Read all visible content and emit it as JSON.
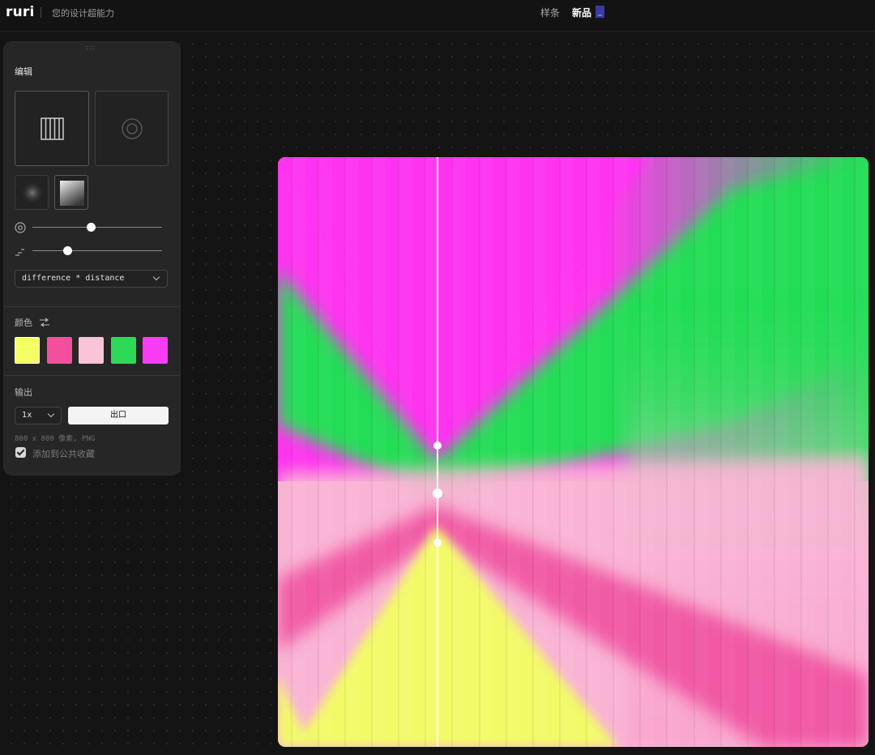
{
  "header": {
    "logo": "ruri",
    "tagline": "您的设计超能力",
    "nav": [
      "样条",
      "新品"
    ],
    "nav_badge": "_"
  },
  "panel": {
    "grip": ":::",
    "edit_title": "编辑",
    "dropdown_value": "difference * distance",
    "sliders": [
      {
        "icon": "concentric-circle-icon",
        "level": 0.45
      },
      {
        "icon": "gradient-ramp-icon",
        "level": 0.27
      }
    ],
    "colors_title": "颜色",
    "swatches": [
      "#f4ff63",
      "#f34f9e",
      "#fbc3d8",
      "#2ed957",
      "#f73cf4"
    ],
    "output_title": "输出",
    "scale_value": "1x",
    "export_label": "出口",
    "meta": "800 x 800 像素, PNG",
    "publish_label": "添加到公共收藏",
    "publish_checked": true
  },
  "canvas": {
    "colors": {
      "magenta": "#ff33f0",
      "green": "#22dd55",
      "pink": "#f9b4d4",
      "hotpink": "#f04b9e",
      "yellow": "#f3fa67"
    },
    "stripes": 22
  }
}
